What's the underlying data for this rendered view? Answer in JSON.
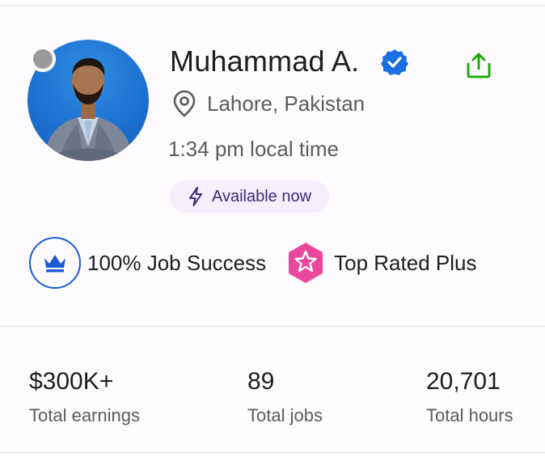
{
  "profile": {
    "name": "Muhammad A.",
    "location": "Lahore, Pakistan",
    "local_time": "1:34 pm local time",
    "availability": "Available now"
  },
  "badges": {
    "job_success": "100% Job Success",
    "top_rated": "Top Rated Plus"
  },
  "stats": [
    {
      "value": "$300K+",
      "label": "Total earnings"
    },
    {
      "value": "89",
      "label": "Total jobs"
    },
    {
      "value": "20,701",
      "label": "Total hours"
    }
  ],
  "icons": {
    "status": "status-dot",
    "verified": "verified-check-icon",
    "share": "share-icon",
    "location": "location-pin-icon",
    "bolt": "lightning-bolt-icon",
    "crown": "crown-icon",
    "star": "star-badge-icon"
  },
  "colors": {
    "verified_blue": "#1a6fe0",
    "share_green": "#14a800",
    "crown_blue": "#1a5bd6",
    "star_pink": "#e9489c",
    "available_bg": "#f4effb",
    "available_text": "#3d2a78"
  }
}
